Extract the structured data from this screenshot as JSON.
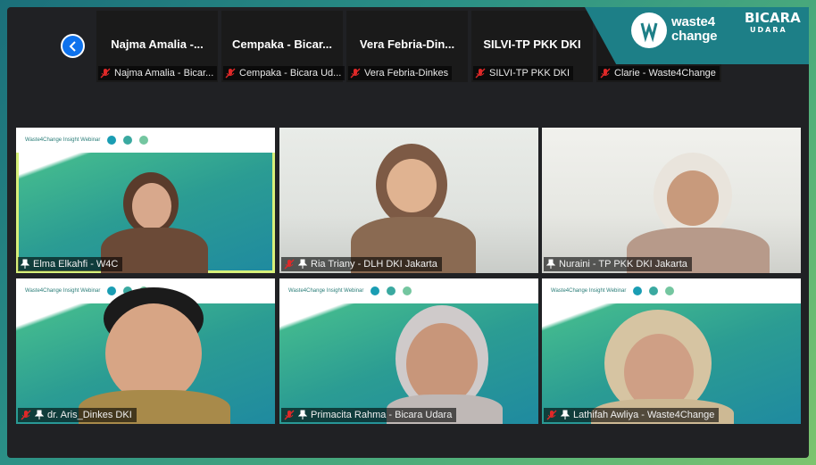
{
  "strip": {
    "tiles": [
      {
        "name": "Najma Amalia -...",
        "label": "Najma Amalia - Bicar..."
      },
      {
        "name": "Cempaka - Bicar...",
        "label": "Cempaka - Bicara Ud..."
      },
      {
        "name": "Vera Febria-Din...",
        "label": "Vera Febria-Dinkes"
      },
      {
        "name": "SILVI-TP PKK DKI",
        "label": "SILVI-TP PKK DKI"
      },
      {
        "name": "",
        "label": "Clarie - Waste4Change"
      }
    ]
  },
  "brand": {
    "logo1_line1": "waste4",
    "logo1_line2": "change",
    "logo2_line1": "BICARA",
    "logo2_line2": "UDARA"
  },
  "tiles": [
    {
      "label": "Elma Elkahfi - W4C",
      "slide_title": "Waste4Change Insight Webinar"
    },
    {
      "label": "Ria Triany - DLH DKI Jakarta"
    },
    {
      "label": "Nuraini - TP PKK DKI Jakarta"
    },
    {
      "label": "dr. Aris_Dinkes DKI",
      "slide_title": "Waste4Change Insight Webinar"
    },
    {
      "label": "Primacita Rahma - Bicara Udara",
      "slide_title": "Waste4Change Insight Webinar"
    },
    {
      "label": "Lathifah Awliya - Waste4Change",
      "slide_title": "Waste4Change Insight Webinar"
    }
  ],
  "colors": {
    "nav_button": "#0e72ed",
    "active_speaker": "#d7f07a",
    "muted_mic": "#e02828"
  }
}
